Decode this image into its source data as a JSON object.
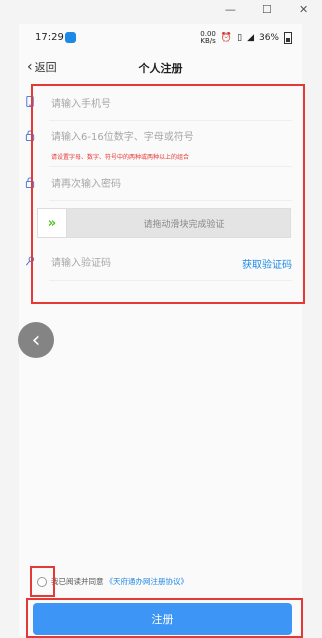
{
  "statusbar": {
    "time": "17:29",
    "speed_top": "0.00",
    "speed_bottom": "KB/s",
    "battery": "36%"
  },
  "nav": {
    "back_label": "返回",
    "title": "个人注册"
  },
  "form": {
    "phone_placeholder": "请输入手机号",
    "password_placeholder": "请输入6-16位数字、字母或符号",
    "password_hint": "请设置字母、数字、符号中的两种或两种以上的组合",
    "confirm_placeholder": "请再次输入密码",
    "slider_text": "请拖动滑块完成验证",
    "code_placeholder": "请输入验证码",
    "get_code_label": "获取验证码"
  },
  "agreement": {
    "text": "我已阅读并同意",
    "link": "《天府通办网注册协议》"
  },
  "register_button": "注册",
  "colors": {
    "accent": "#1e88e5",
    "button": "#3d95f5",
    "hint": "#e53935",
    "slider_arrow": "#52c41a"
  }
}
